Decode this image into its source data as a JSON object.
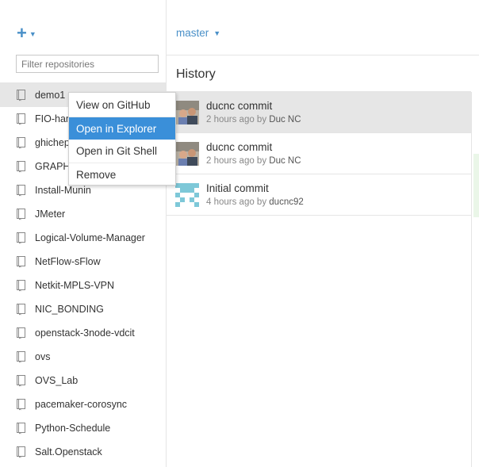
{
  "sidebar": {
    "add_icon": "plus-icon",
    "filter_placeholder": "Filter repositories",
    "repos": [
      {
        "name": "demo1",
        "selected": true
      },
      {
        "name": "FIO-hard"
      },
      {
        "name": "ghichep"
      },
      {
        "name": "GRAPHIT"
      },
      {
        "name": "Install-Munin"
      },
      {
        "name": "JMeter"
      },
      {
        "name": "Logical-Volume-Manager"
      },
      {
        "name": "NetFlow-sFlow"
      },
      {
        "name": "Netkit-MPLS-VPN"
      },
      {
        "name": "NIC_BONDING"
      },
      {
        "name": "openstack-3node-vdcit"
      },
      {
        "name": "ovs"
      },
      {
        "name": "OVS_Lab"
      },
      {
        "name": "pacemaker-corosync"
      },
      {
        "name": "Python-Schedule"
      },
      {
        "name": "Salt.Openstack"
      }
    ]
  },
  "header": {
    "branch": "master"
  },
  "history": {
    "title": "History",
    "commits": [
      {
        "title": "ducnc commit",
        "time": "2 hours ago by ",
        "author": "Duc NC",
        "avatar": "photo",
        "selected": true
      },
      {
        "title": "ducnc commit",
        "time": "2 hours ago by ",
        "author": "Duc NC",
        "avatar": "photo"
      },
      {
        "title": "Initial commit",
        "time": "4 hours ago by ",
        "author": "ducnc92",
        "avatar": "identicon"
      }
    ]
  },
  "context_menu": {
    "items": [
      {
        "label": "View on GitHub"
      },
      {
        "label": "Open in Explorer",
        "highlighted": true
      },
      {
        "label": "Open in Git Shell"
      },
      {
        "label": "Remove"
      }
    ]
  },
  "colors": {
    "accent": "#4a90c8",
    "menu_highlight": "#3a8fd9",
    "selected_row": "#e6e6e6",
    "identicon": "#7ec8d8"
  }
}
